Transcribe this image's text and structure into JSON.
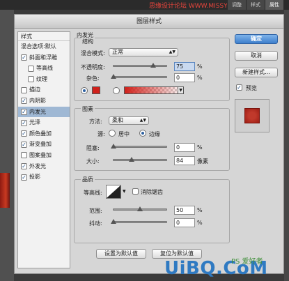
{
  "topbar": {
    "watermark": "思缘设计论坛 WWW.MISSYUAN.COM",
    "tabs": [
      "调整",
      "样式",
      "属性"
    ],
    "active_tab": 2
  },
  "dialog": {
    "title": "图层样式",
    "styles_header": "样式",
    "blend_options": "混合选项:默认",
    "styles": [
      {
        "label": "斜面和浮雕",
        "checked": true,
        "sub": false
      },
      {
        "label": "等高线",
        "checked": false,
        "sub": true
      },
      {
        "label": "纹理",
        "checked": false,
        "sub": true
      },
      {
        "label": "描边",
        "checked": false,
        "sub": false
      },
      {
        "label": "内阴影",
        "checked": true,
        "sub": false
      },
      {
        "label": "内发光",
        "checked": true,
        "sub": false,
        "selected": true
      },
      {
        "label": "光泽",
        "checked": true,
        "sub": false
      },
      {
        "label": "颜色叠加",
        "checked": true,
        "sub": false
      },
      {
        "label": "渐变叠加",
        "checked": true,
        "sub": false
      },
      {
        "label": "图案叠加",
        "checked": false,
        "sub": false
      },
      {
        "label": "外发光",
        "checked": true,
        "sub": false
      },
      {
        "label": "投影",
        "checked": true,
        "sub": false
      }
    ],
    "panel_title": "内发光",
    "structure": {
      "label": "结构",
      "blend_mode_label": "混合模式:",
      "blend_mode_value": "正常",
      "opacity_label": "不透明度:",
      "opacity_value": "75",
      "noise_label": "杂色:",
      "noise_value": "0",
      "percent": "%",
      "color": "#d0201a",
      "opacity_level": 0.75,
      "noise_level": 0
    },
    "elements": {
      "label": "图素",
      "method_label": "方法:",
      "method_value": "柔和",
      "source_label": "源:",
      "source_center": "居中",
      "source_edge": "边缘",
      "choke_label": "阻塞:",
      "choke_value": "0",
      "size_label": "大小:",
      "size_value": "84",
      "size_unit": "像素",
      "choke_level": 0,
      "size_level": 0.34
    },
    "quality": {
      "label": "品质",
      "contour_label": "等高线:",
      "anti_alias_label": "消除锯齿",
      "range_label": "范围:",
      "range_value": "50",
      "jitter_label": "抖动:",
      "jitter_value": "0",
      "range_level": 0.5,
      "jitter_level": 0
    },
    "buttons": {
      "make_default": "设置为默认值",
      "reset_default": "复位为默认值",
      "ok": "确定",
      "cancel": "取消",
      "new_style": "新建样式...",
      "preview": "预览"
    }
  },
  "watermark_bottom": {
    "brand": "UiBQ.CoM",
    "ps": "PS 爱好者"
  }
}
